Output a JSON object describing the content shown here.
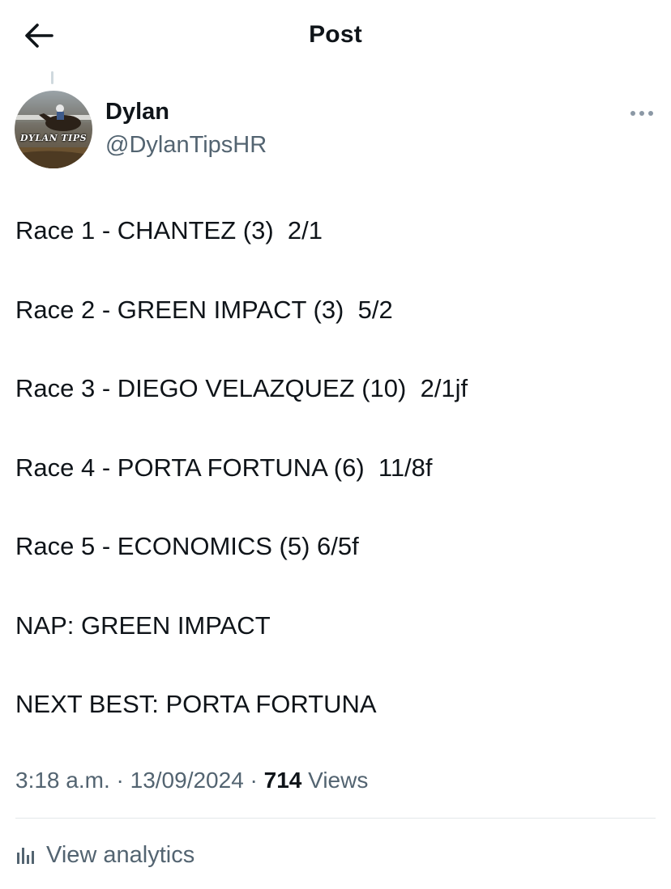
{
  "header": {
    "back_icon": "arrow-left-icon",
    "title": "Post"
  },
  "author": {
    "name": "Dylan",
    "handle": "@DylanTipsHR",
    "avatar_text": "DYLAN TIPS"
  },
  "more_icon": "more-horizontal-icon",
  "post": {
    "lines": [
      "Race 1 - CHANTEZ (3)  2/1",
      "Race 2 - GREEN IMPACT (3)  5/2",
      "Race 3 - DIEGO VELAZQUEZ (10)  2/1jf",
      "Race 4 - PORTA FORTUNA (6)  11/8f",
      "Race 5 - ECONOMICS (5) 6/5f",
      "NAP: GREEN IMPACT",
      "NEXT BEST: PORTA FORTUNA"
    ]
  },
  "meta": {
    "time": "3:18 a.m.",
    "separator": " · ",
    "date": "13/09/2024",
    "views_count": "714",
    "views_label": " Views"
  },
  "analytics": {
    "icon": "bar-chart-icon",
    "label": "View analytics"
  },
  "colors": {
    "text": "#0f1419",
    "secondary": "#536471",
    "divider": "#e4e8ea"
  }
}
